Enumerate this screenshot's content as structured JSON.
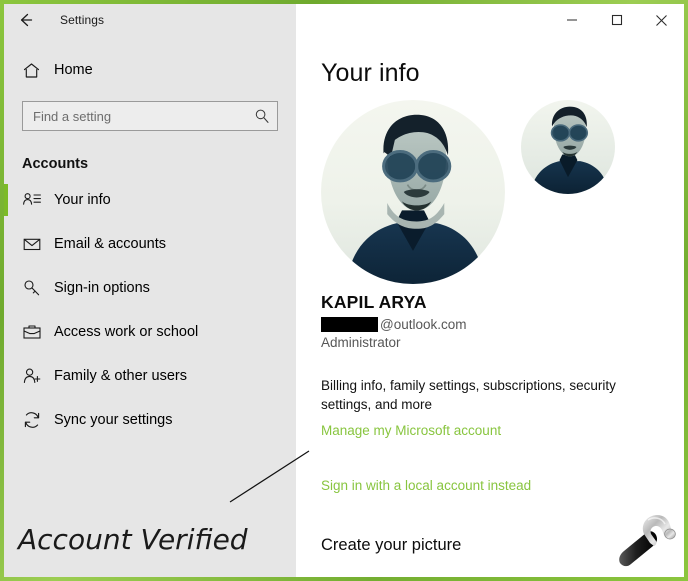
{
  "window": {
    "app_title": "Settings",
    "back_icon": "back-arrow-icon",
    "controls": {
      "minimize": "minimize-icon",
      "maximize": "maximize-icon",
      "close": "close-icon"
    },
    "border_color": "#8cc63e"
  },
  "sidebar": {
    "home": {
      "label": "Home",
      "icon": "home-icon"
    },
    "search": {
      "placeholder": "Find a setting",
      "value": "",
      "icon": "search-icon"
    },
    "section_header": "Accounts",
    "items": [
      {
        "label": "Your info",
        "icon": "contact-card-icon",
        "selected": true
      },
      {
        "label": "Email & accounts",
        "icon": "envelope-icon",
        "selected": false
      },
      {
        "label": "Sign-in options",
        "icon": "key-icon",
        "selected": false
      },
      {
        "label": "Access work or school",
        "icon": "briefcase-icon",
        "selected": false
      },
      {
        "label": "Family & other users",
        "icon": "person-add-icon",
        "selected": false
      },
      {
        "label": "Sync your settings",
        "icon": "sync-icon",
        "selected": false
      }
    ],
    "selection_color": "#7cbb27"
  },
  "annotation": {
    "text": "Account Verified",
    "pointer": "callout-line"
  },
  "main": {
    "page_title": "Your info",
    "avatars": {
      "large": "profile-photo-large",
      "small": "profile-photo-small"
    },
    "account": {
      "name": "KAPIL ARYA",
      "email_redacted": true,
      "email_domain": "@outlook.com",
      "role": "Administrator"
    },
    "billing_text": "Billing info, family settings, subscriptions, security settings, and more",
    "manage_account_link": "Manage my Microsoft account",
    "local_account_link": "Sign in with a local account instead",
    "create_picture_title": "Create your picture",
    "link_color": "#88c53f"
  },
  "watermark": {
    "icon": "hammer-icon"
  }
}
